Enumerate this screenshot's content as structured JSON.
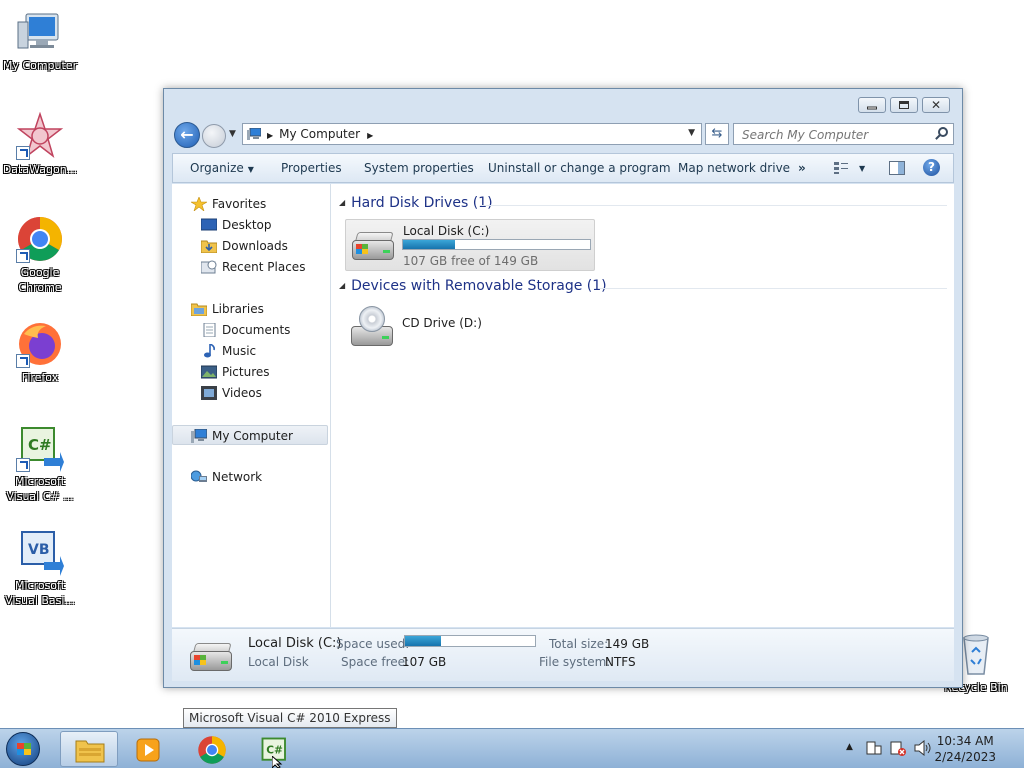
{
  "desktop": {
    "icons": [
      {
        "label1": "My Computer",
        "label2": ""
      },
      {
        "label1": "DataWagon...",
        "label2": ""
      },
      {
        "label1": "Google",
        "label2": "Chrome"
      },
      {
        "label1": "Firefox",
        "label2": ""
      },
      {
        "label1": "Microsoft",
        "label2": "Visual C# ..."
      },
      {
        "label1": "Microsoft",
        "label2": "Visual Basi..."
      },
      {
        "label1": "Recycle Bin",
        "label2": ""
      }
    ]
  },
  "window": {
    "address": {
      "crumb": "My Computer"
    },
    "search": {
      "placeholder": "Search My Computer"
    },
    "toolbar": {
      "organize": "Organize",
      "properties": "Properties",
      "system_properties": "System properties",
      "uninstall": "Uninstall or change a program",
      "map_drive": "Map network drive",
      "more": "»"
    },
    "nav": {
      "favorites": "Favorites",
      "desktop": "Desktop",
      "downloads": "Downloads",
      "recent": "Recent Places",
      "libraries": "Libraries",
      "documents": "Documents",
      "music": "Music",
      "pictures": "Pictures",
      "videos": "Videos",
      "computer": "My Computer",
      "network": "Network"
    },
    "groups": {
      "hdd_header": "Hard Disk Drives (1)",
      "removable_header": "Devices with Removable Storage (1)"
    },
    "drives": {
      "c": {
        "name": "Local Disk (C:)",
        "free": "107 GB free of 149 GB",
        "used_fraction": 0.28
      },
      "d": {
        "name": "CD Drive (D:)"
      }
    },
    "details": {
      "name": "Local Disk (C:)",
      "type": "Local Disk",
      "space_used_label": "Space used:",
      "space_free_label": "Space free:",
      "space_free": "107 GB",
      "total_size_label": "Total size:",
      "total_size": "149 GB",
      "filesystem_label": "File system:",
      "filesystem": "NTFS",
      "used_fraction": 0.28
    }
  },
  "taskbar": {
    "tooltip": "Microsoft Visual C# 2010 Express",
    "time": "10:34 AM",
    "date": "2/24/2023"
  },
  "colors": {
    "accent": "#1773ad",
    "header_text": "#1e3287"
  }
}
